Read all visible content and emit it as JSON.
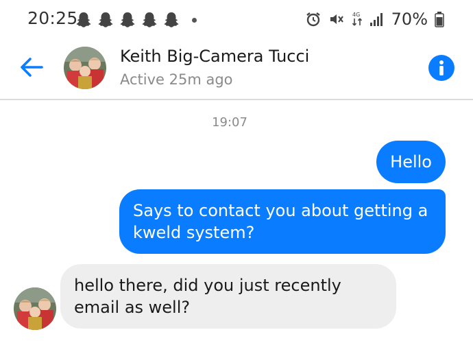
{
  "status_bar": {
    "time": "20:25",
    "notification_icons": [
      "snapchat-icon",
      "snapchat-icon",
      "snapchat-icon",
      "snapchat-icon",
      "snapchat-icon",
      "more-dot-icon"
    ],
    "system_icons": [
      "alarm-icon",
      "mute-icon",
      "data-transfer-icon",
      "signal-icon",
      "battery-icon"
    ],
    "battery": "70%"
  },
  "header": {
    "contact_name": "Keith Big-Camera Tucci",
    "active_status": "Active 25m ago",
    "back_icon": "arrow-left-icon",
    "info_icon": "info-icon"
  },
  "chat": {
    "timestamp": "19:07",
    "messages": [
      {
        "direction": "outgoing",
        "text": "Hello"
      },
      {
        "direction": "outgoing",
        "text": "Says to contact you about getting a kweld system?"
      },
      {
        "direction": "incoming",
        "text": "hello there, did you just recently email as well?"
      }
    ]
  },
  "colors": {
    "accent": "#0a7cff",
    "incoming_bubble": "#eeeeee",
    "muted_text": "#8a8a8a"
  }
}
